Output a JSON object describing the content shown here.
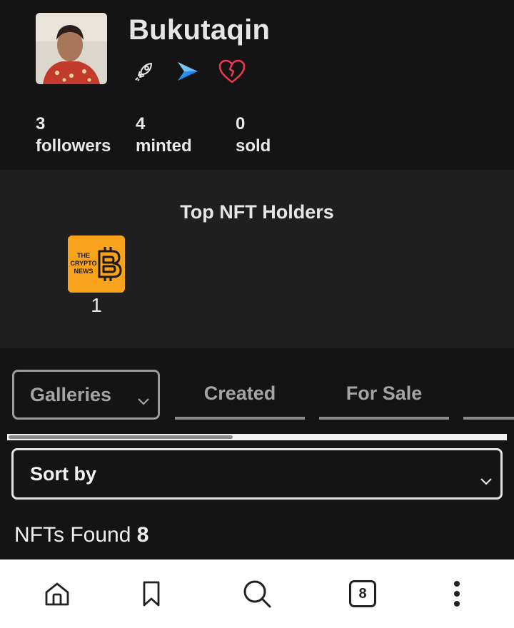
{
  "profile": {
    "username": "Bukutaqin",
    "badges": [
      "rocket-icon",
      "brand-arrow-icon",
      "heart-icon"
    ],
    "stats": [
      {
        "value": "3",
        "label": "followers"
      },
      {
        "value": "4",
        "label": "minted"
      },
      {
        "value": "0",
        "label": "sold"
      }
    ]
  },
  "holders": {
    "title": "Top NFT Holders",
    "items": [
      {
        "logo_text": [
          "THE",
          "CRYPTO",
          "NEWS"
        ],
        "count": "1"
      }
    ]
  },
  "tabs": {
    "selected": "Galleries",
    "items": [
      "Created",
      "For Sale"
    ]
  },
  "sort": {
    "label": "Sort by"
  },
  "results": {
    "prefix": "NFTs Found",
    "count": "8"
  },
  "nav": {
    "tab_count": "8"
  },
  "colors": {
    "background": "#141414",
    "panel": "#1f1f1f",
    "accent_orange": "#f9a21b",
    "heart": "#e8394f",
    "brand_blue": "#1f8bf2"
  }
}
